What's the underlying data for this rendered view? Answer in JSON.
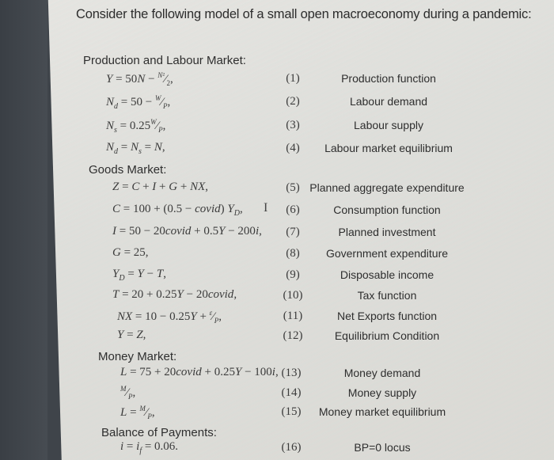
{
  "intro": "Consider the following model of a small open macroeconomy during a pandemic:",
  "sections": [
    {
      "title": "Production and Labour Market:",
      "equations": [
        {
          "expr": "Y = 50N − N²/2,",
          "num": "(1)",
          "desc": "Production function"
        },
        {
          "expr": "N_d = 50 − W/P,",
          "num": "(2)",
          "desc": "Labour demand"
        },
        {
          "expr": "N_s = 0.25 W/P,",
          "num": "(3)",
          "desc": "Labour supply"
        },
        {
          "expr": "N_d = N_s = N,",
          "num": "(4)",
          "desc": "Labour market equilibrium"
        }
      ]
    },
    {
      "title": "Goods Market:",
      "equations": [
        {
          "expr": "Z = C + I + G + NX,",
          "num": "(5)",
          "desc": "Planned aggregate expenditure"
        },
        {
          "expr": "C = 100 + (0.5 − covid) Y_D,",
          "num": "(6)",
          "desc": "Consumption function"
        },
        {
          "expr": "I = 50 − 20covid + 0.5Y − 200i,",
          "num": "(7)",
          "desc": "Planned investment"
        },
        {
          "expr": "G = 25,",
          "num": "(8)",
          "desc": "Government expenditure"
        },
        {
          "expr": "Y_D = Y − T,",
          "num": "(9)",
          "desc": "Disposable income"
        },
        {
          "expr": "T = 20 + 0.25Y − 20covid,",
          "num": "(10)",
          "desc": "Tax function"
        },
        {
          "expr": "NX = 10 − 0.25Y + ε/P,",
          "num": "(11)",
          "desc": "Net Exports function"
        },
        {
          "expr": "Y = Z,",
          "num": "(12)",
          "desc": "Equilibrium Condition"
        }
      ]
    },
    {
      "title": "Money Market:",
      "equations": [
        {
          "expr": "L = 75 + 20covid + 0.25Y − 100i,",
          "num": "(13)",
          "desc": "Money demand"
        },
        {
          "expr": "M/P,",
          "num": "(14)",
          "desc": "Money supply"
        },
        {
          "expr": "L = M/P,",
          "num": "(15)",
          "desc": "Money market equilibrium"
        }
      ]
    },
    {
      "title": "Balance of Payments:",
      "equations": [
        {
          "expr": "i = i_f = 0.06.",
          "num": "(16)",
          "desc": "BP=0 locus"
        }
      ]
    }
  ],
  "cursor_icon": "text-cursor-icon"
}
